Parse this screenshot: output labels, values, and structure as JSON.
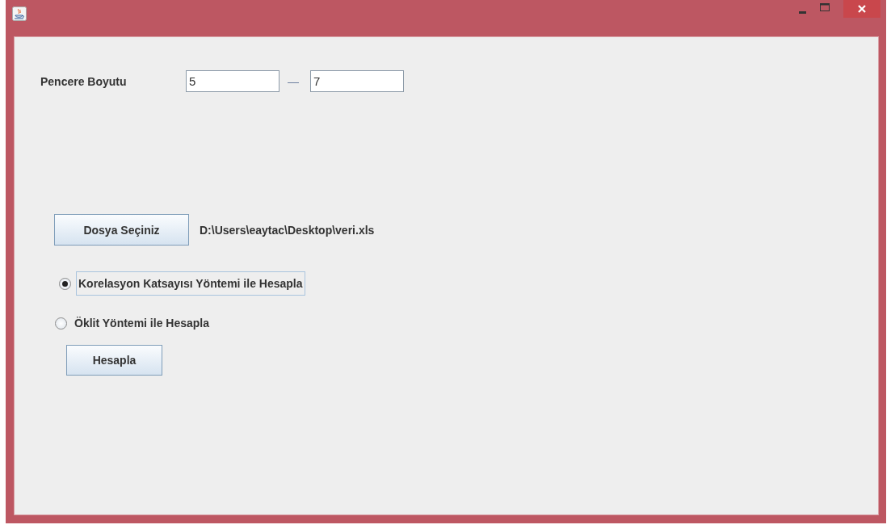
{
  "window": {
    "controls": [
      {
        "kind": "minimize"
      },
      {
        "kind": "maximize"
      },
      {
        "kind": "close"
      }
    ]
  },
  "window_size": {
    "label": "Pencere Boyutu",
    "from": "5",
    "separator": "—",
    "to": "7"
  },
  "file": {
    "button": "Dosya Seçiniz",
    "path": "D:\\Users\\eaytac\\Desktop\\veri.xls"
  },
  "methods": [
    {
      "label": "Korelasyon Katsayısı Yöntemi ile Hesapla",
      "selected": true
    },
    {
      "label": "Öklit Yöntemi ile Hesapla",
      "selected": false
    }
  ],
  "calculate_button": "Hesapla"
}
